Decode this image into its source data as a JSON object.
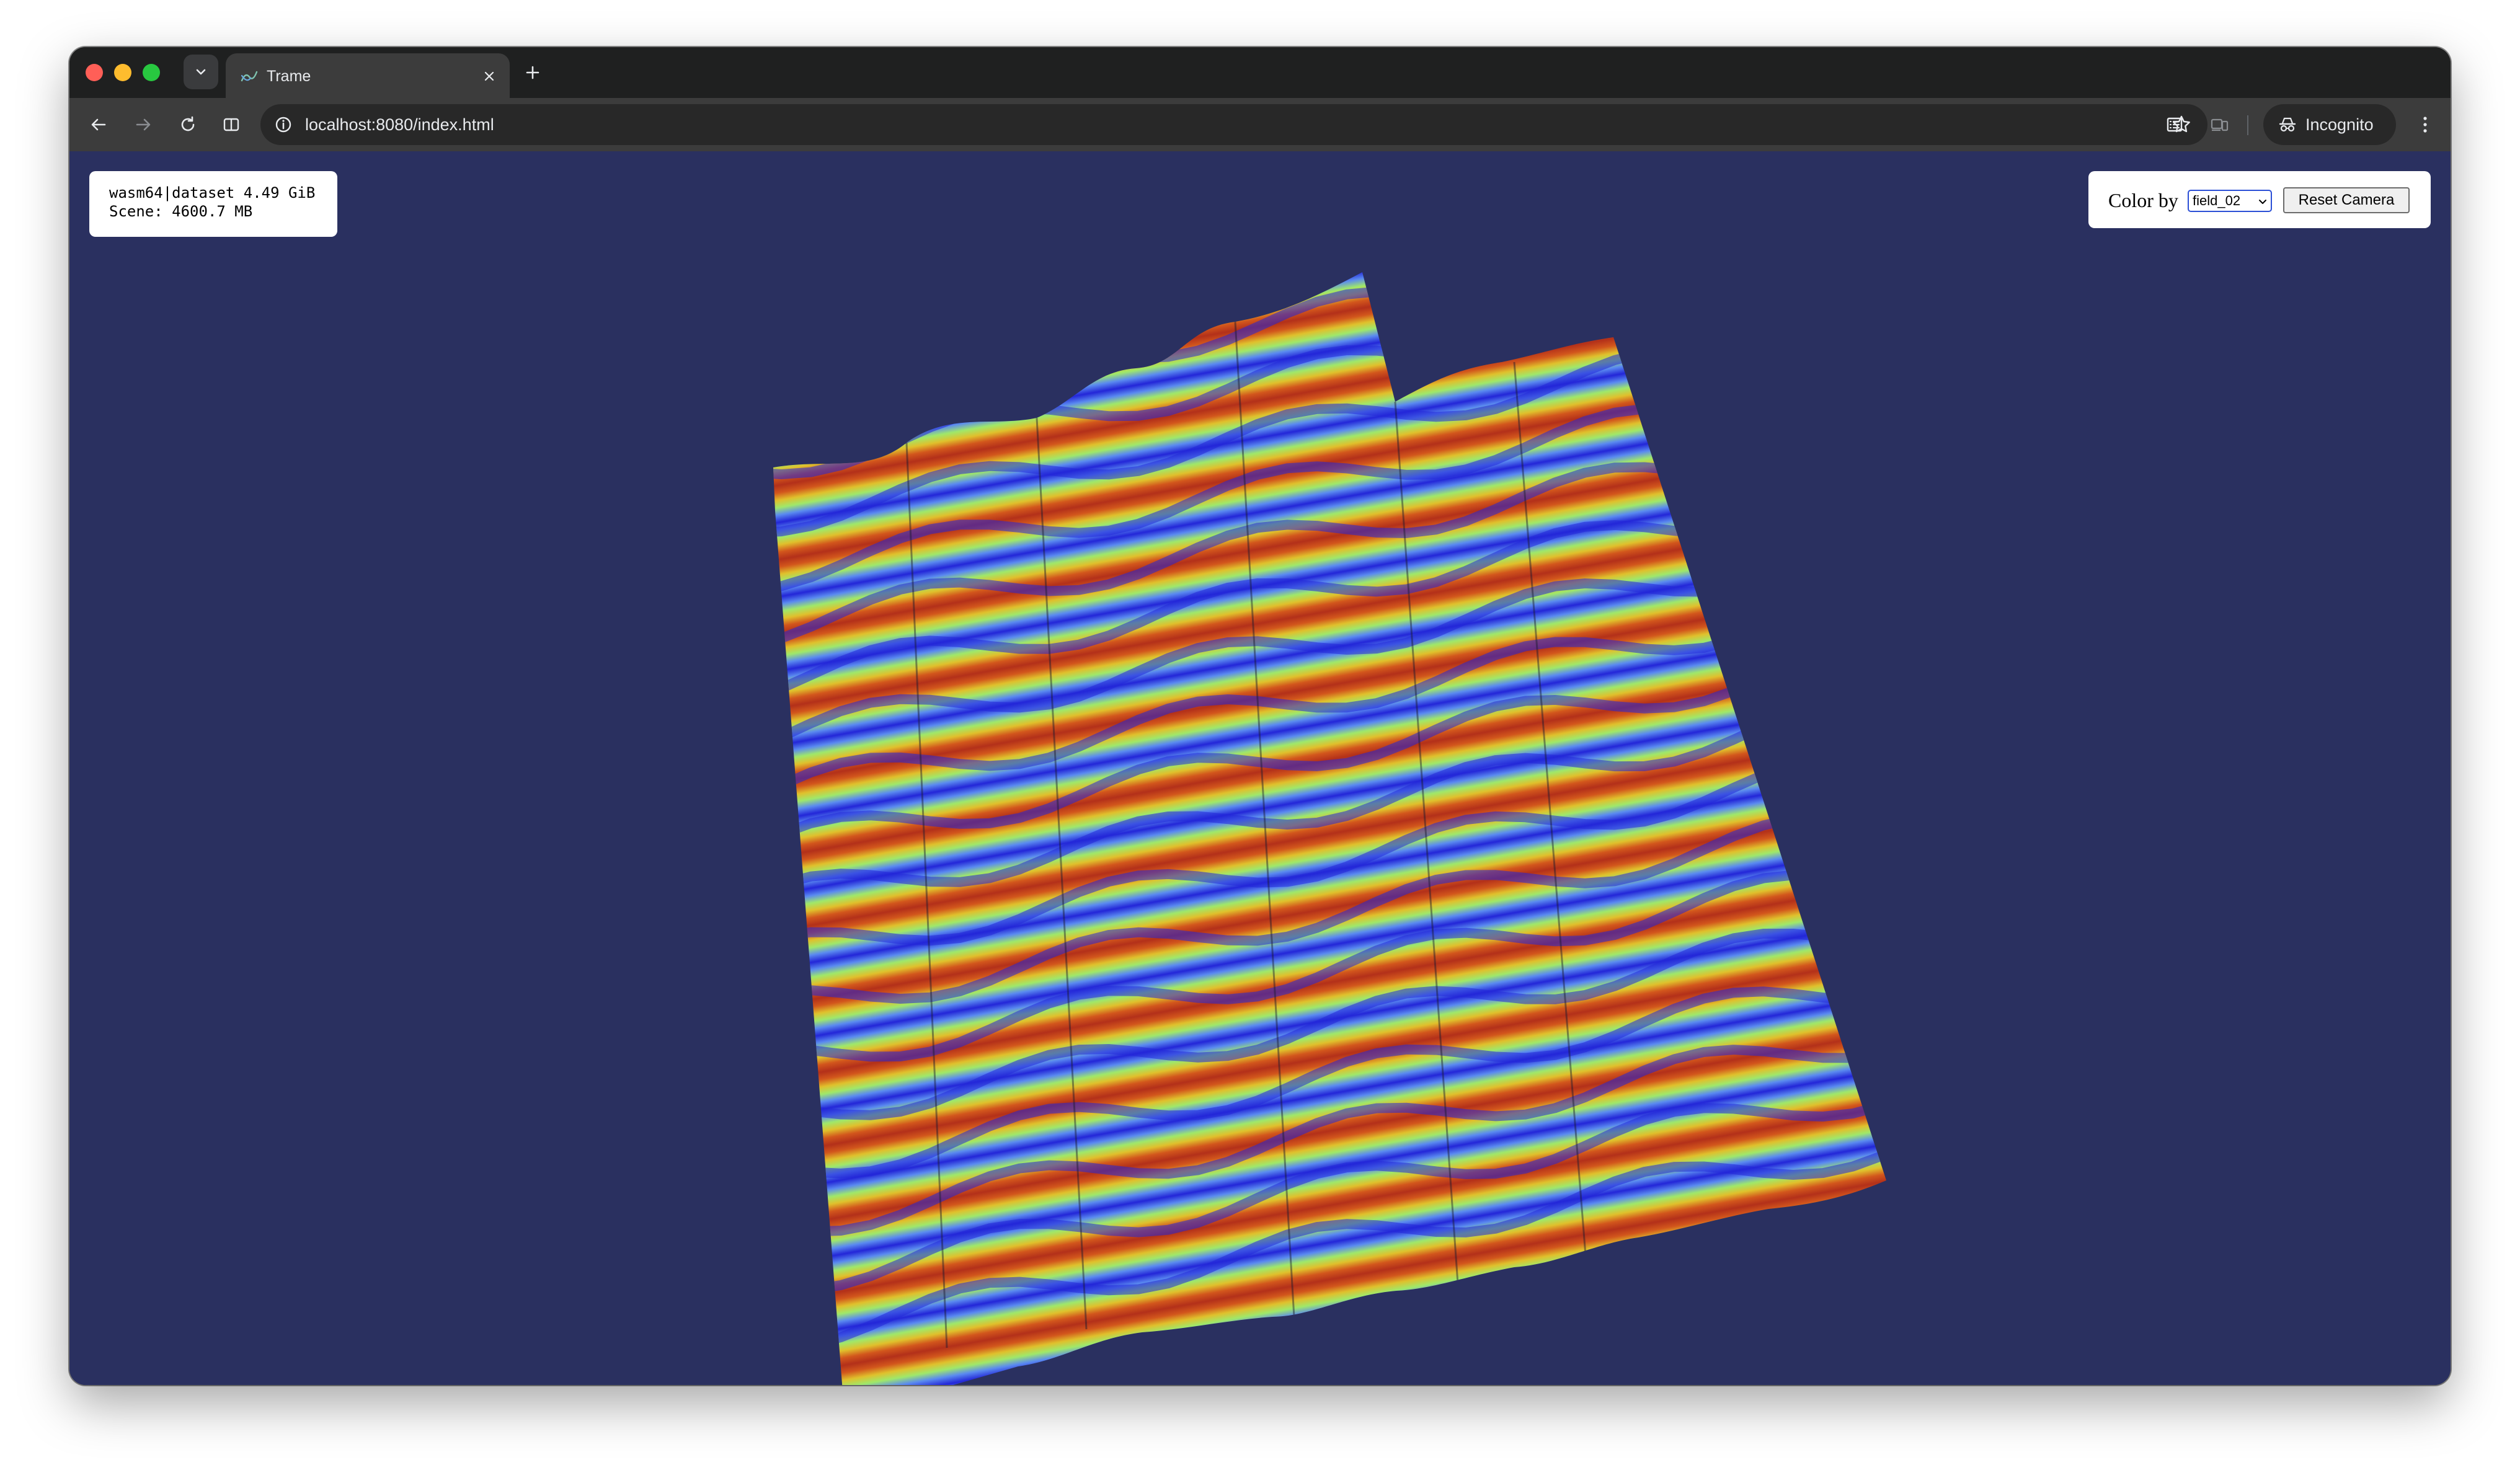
{
  "browser": {
    "tab": {
      "title": "Trame"
    },
    "address_bar": {
      "url": "localhost:8080/index.html"
    },
    "profile": {
      "label": "Incognito"
    },
    "icons": {
      "back": "arrow-left-icon",
      "forward": "arrow-right-icon",
      "reload": "reload-icon",
      "split": "split-view-icon",
      "site_info": "info-icon",
      "bookmark": "star-icon",
      "reading": "reading-list-icon",
      "devices": "devices-icon",
      "menu": "kebab-menu-icon"
    }
  },
  "app": {
    "background_color": "#2a3060",
    "info_panel": {
      "line1": "wasm64|dataset 4.49 GiB",
      "line2": "Scene: 4600.7 MB"
    },
    "controls": {
      "color_by_label": "Color by",
      "color_by_value": "field_02",
      "reset_camera_label": "Reset Camera"
    },
    "surface_colormap": [
      "#2326d8",
      "#5a8af0",
      "#9fe86a",
      "#e0c02c",
      "#d2561c",
      "#b3301a"
    ]
  }
}
